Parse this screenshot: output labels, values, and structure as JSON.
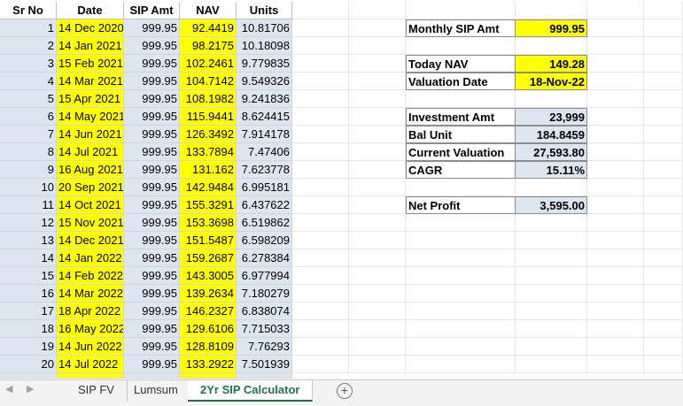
{
  "headers": [
    "Sr No",
    "Date",
    "SIP Amt",
    "NAV",
    "Units"
  ],
  "rows": [
    [
      "1",
      "14 Dec 2020",
      "999.95",
      "92.4419",
      "10.81706"
    ],
    [
      "2",
      "14 Jan 2021",
      "999.95",
      "98.2175",
      "10.18098"
    ],
    [
      "3",
      "15 Feb 2021",
      "999.95",
      "102.2461",
      "9.779835"
    ],
    [
      "4",
      "14 Mar 2021",
      "999.95",
      "104.7142",
      "9.549326"
    ],
    [
      "5",
      "15 Apr 2021",
      "999.95",
      "108.1982",
      "9.241836"
    ],
    [
      "6",
      "14 May 2021",
      "999.95",
      "115.9441",
      "8.624415"
    ],
    [
      "7",
      "14 Jun 2021",
      "999.95",
      "126.3492",
      "7.914178"
    ],
    [
      "8",
      "14 Jul 2021",
      "999.95",
      "133.7894",
      "7.47406"
    ],
    [
      "9",
      "16 Aug 2021",
      "999.95",
      "131.162",
      "7.623778"
    ],
    [
      "10",
      "20 Sep 2021",
      "999.95",
      "142.9484",
      "6.995181"
    ],
    [
      "11",
      "14 Oct 2021",
      "999.95",
      "155.3291",
      "6.437622"
    ],
    [
      "12",
      "15 Nov 2021",
      "999.95",
      "153.3698",
      "6.519862"
    ],
    [
      "13",
      "14 Dec 2021",
      "999.95",
      "151.5487",
      "6.598209"
    ],
    [
      "14",
      "14 Jan 2022",
      "999.95",
      "159.2687",
      "6.278384"
    ],
    [
      "15",
      "14 Feb 2022",
      "999.95",
      "143.3005",
      "6.977994"
    ],
    [
      "16",
      "14 Mar 2022",
      "999.95",
      "139.2634",
      "7.180279"
    ],
    [
      "17",
      "18 Apr 2022",
      "999.95",
      "146.2327",
      "6.838074"
    ],
    [
      "18",
      "16 May 2022",
      "999.95",
      "129.6106",
      "7.715033"
    ],
    [
      "19",
      "14 Jun 2022",
      "999.95",
      "128.8109",
      "7.76293"
    ],
    [
      "20",
      "14 Jul 2022",
      "999.95",
      "133.2922",
      "7.501939"
    ]
  ],
  "summary": {
    "monthly_sip_label": "Monthly SIP Amt",
    "monthly_sip_value": "999.95",
    "today_nav_label": "Today  NAV",
    "today_nav_value": "149.28",
    "valuation_date_label": "Valuation Date",
    "valuation_date_value": "18-Nov-22",
    "investment_label": "Investment Amt",
    "investment_value": "23,999",
    "bal_unit_label": "Bal Unit",
    "bal_unit_value": "184.8459",
    "current_valuation_label": "Current Valuation",
    "current_valuation_value": "27,593.80",
    "cagr_label": "CAGR",
    "cagr_value": "15.11%",
    "net_profit_label": "Net Profit",
    "net_profit_value": "3,595.00"
  },
  "tabs": [
    "SIP FV",
    "Lumsum",
    "2Yr SIP Calculator"
  ],
  "active_tab": "2Yr SIP Calculator",
  "colors": {
    "highlight_yellow": "#ffff00",
    "light_blue": "#dce6f1",
    "excel_green": "#217346"
  },
  "icons": {
    "prev_sheet": "chevron-left-icon",
    "next_sheet": "chevron-right-icon",
    "add_sheet": "plus-circle-icon"
  }
}
